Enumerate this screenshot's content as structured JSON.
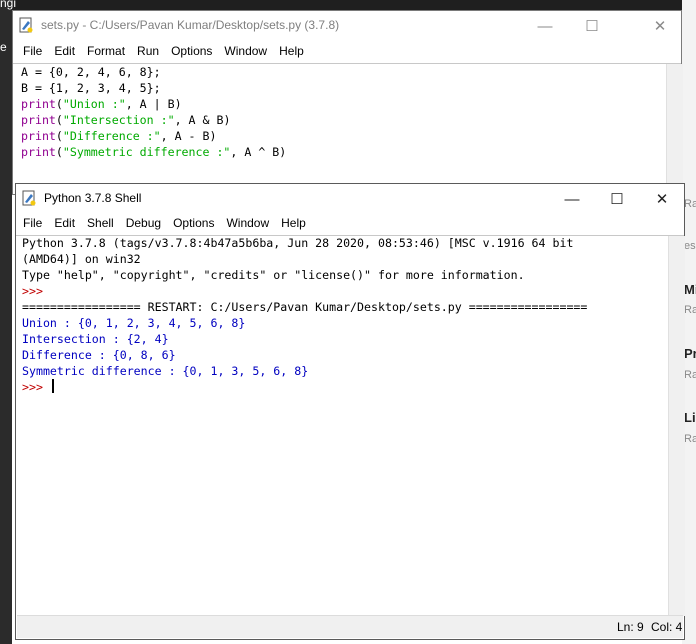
{
  "background": {
    "frag_top": "ngi",
    "frag_left": "e",
    "side": [
      {
        "text": "Ra",
        "big": false
      },
      {
        "text": "es",
        "big": false
      },
      {
        "text": "Mi",
        "big": true
      },
      {
        "text": "Ra",
        "big": false
      },
      {
        "text": "Pr",
        "big": true
      },
      {
        "text": "Ra",
        "big": false
      },
      {
        "text": "Lir",
        "big": true
      },
      {
        "text": "Ra",
        "big": false
      }
    ]
  },
  "editor": {
    "title": "sets.py - C:/Users/Pavan Kumar/Desktop/sets.py (3.7.8)",
    "menu": [
      "File",
      "Edit",
      "Format",
      "Run",
      "Options",
      "Window",
      "Help"
    ],
    "lines": [
      {
        "plain": "A = {0, 2, 4, 6, 8};"
      },
      {
        "plain": "B = {1, 2, 3, 4, 5};"
      },
      {
        "kw": "print",
        "open": "(",
        "str": "\"Union :\"",
        "rest": ", A | B)"
      },
      {
        "kw": "print",
        "open": "(",
        "str": "\"Intersection :\"",
        "rest": ", A & B)"
      },
      {
        "kw": "print",
        "open": "(",
        "str": "\"Difference :\"",
        "rest": ", A - B)"
      },
      {
        "kw": "print",
        "open": "(",
        "str": "\"Symmetric difference :\"",
        "rest": ", A ^ B)"
      }
    ]
  },
  "shell": {
    "title": "Python 3.7.8 Shell",
    "menu": [
      "File",
      "Edit",
      "Shell",
      "Debug",
      "Options",
      "Window",
      "Help"
    ],
    "banner": [
      "Python 3.7.8 (tags/v3.7.8:4b47a5b6ba, Jun 28 2020, 08:53:46) [MSC v.1916 64 bit",
      "(AMD64)] on win32",
      "Type \"help\", \"copyright\", \"credits\" or \"license()\" for more information."
    ],
    "prompt": ">>> ",
    "restart": "================= RESTART: C:/Users/Pavan Kumar/Desktop/sets.py =================",
    "output": [
      "Union : {0, 1, 2, 3, 4, 5, 6, 8}",
      "Intersection : {2, 4}",
      "Difference : {0, 8, 6}",
      "Symmetric difference : {0, 1, 3, 5, 6, 8}"
    ],
    "status": {
      "line": "Ln: 9",
      "col": "Col: 4"
    }
  },
  "window_controls": {
    "minimize": "—",
    "maximize": "☐",
    "close": "✕"
  }
}
